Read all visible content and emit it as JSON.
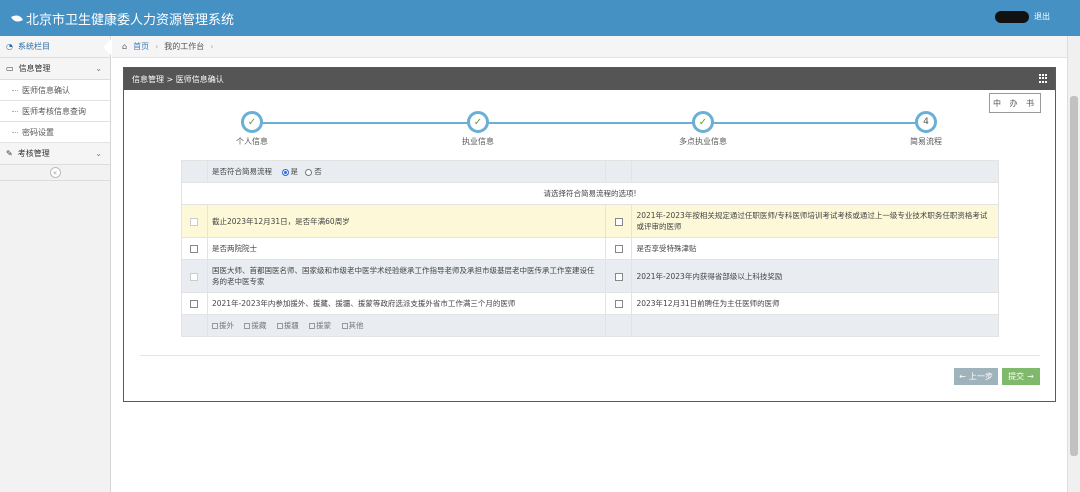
{
  "app": {
    "title": "北京市卫生健康委人力资源管理系统",
    "logout": "退出"
  },
  "sidebar": {
    "header": "系统栏目",
    "menus": [
      {
        "label": "信息管理",
        "items": [
          "医师信息确认",
          "医师考核信息查询",
          "密码设置"
        ]
      },
      {
        "label": "考核管理",
        "items": []
      }
    ]
  },
  "breadcrumb": {
    "home": "首页",
    "current": "我的工作台"
  },
  "panel": {
    "title": "信息管理 > 医师信息确认",
    "stamp": "中 办 书"
  },
  "steps": [
    {
      "label": "个人信息",
      "state": "done"
    },
    {
      "label": "执业信息",
      "state": "done"
    },
    {
      "label": "多点执业信息",
      "state": "done"
    },
    {
      "label": "简易流程",
      "state": "current",
      "number": "4"
    }
  ],
  "form": {
    "question": "是否符合简易流程",
    "yes": "是",
    "no": "否",
    "warning": "请选择符合简易流程的选项!",
    "rows": [
      {
        "left": "截止2023年12月31日，是否年满60周岁",
        "right": "2021年-2023年按相关规定通过任职医师/专科医师培训考试考核或通过上一级专业技术职务任职资格考试或评审的医师"
      },
      {
        "left": "是否两院院士",
        "right": "是否享受特殊津贴"
      },
      {
        "left": "国医大师、首都国医名师、国家级和市级老中医学术经验继承工作指导老师及承担市级基层老中医传承工作室建设任务的老中医专家",
        "right": "2021年-2023年内获得省部级以上科技奖励"
      },
      {
        "left": "2021年-2023年内参加援外、援藏、援疆、援蒙等政府选派支援外省市工作满三个月的医师",
        "right": "2023年12月31日前聘任为主任医师的医师"
      }
    ],
    "aid_options": [
      "援外",
      "援藏",
      "援疆",
      "援蒙",
      "其他"
    ]
  },
  "buttons": {
    "prev": "上一步",
    "submit": "提交"
  }
}
